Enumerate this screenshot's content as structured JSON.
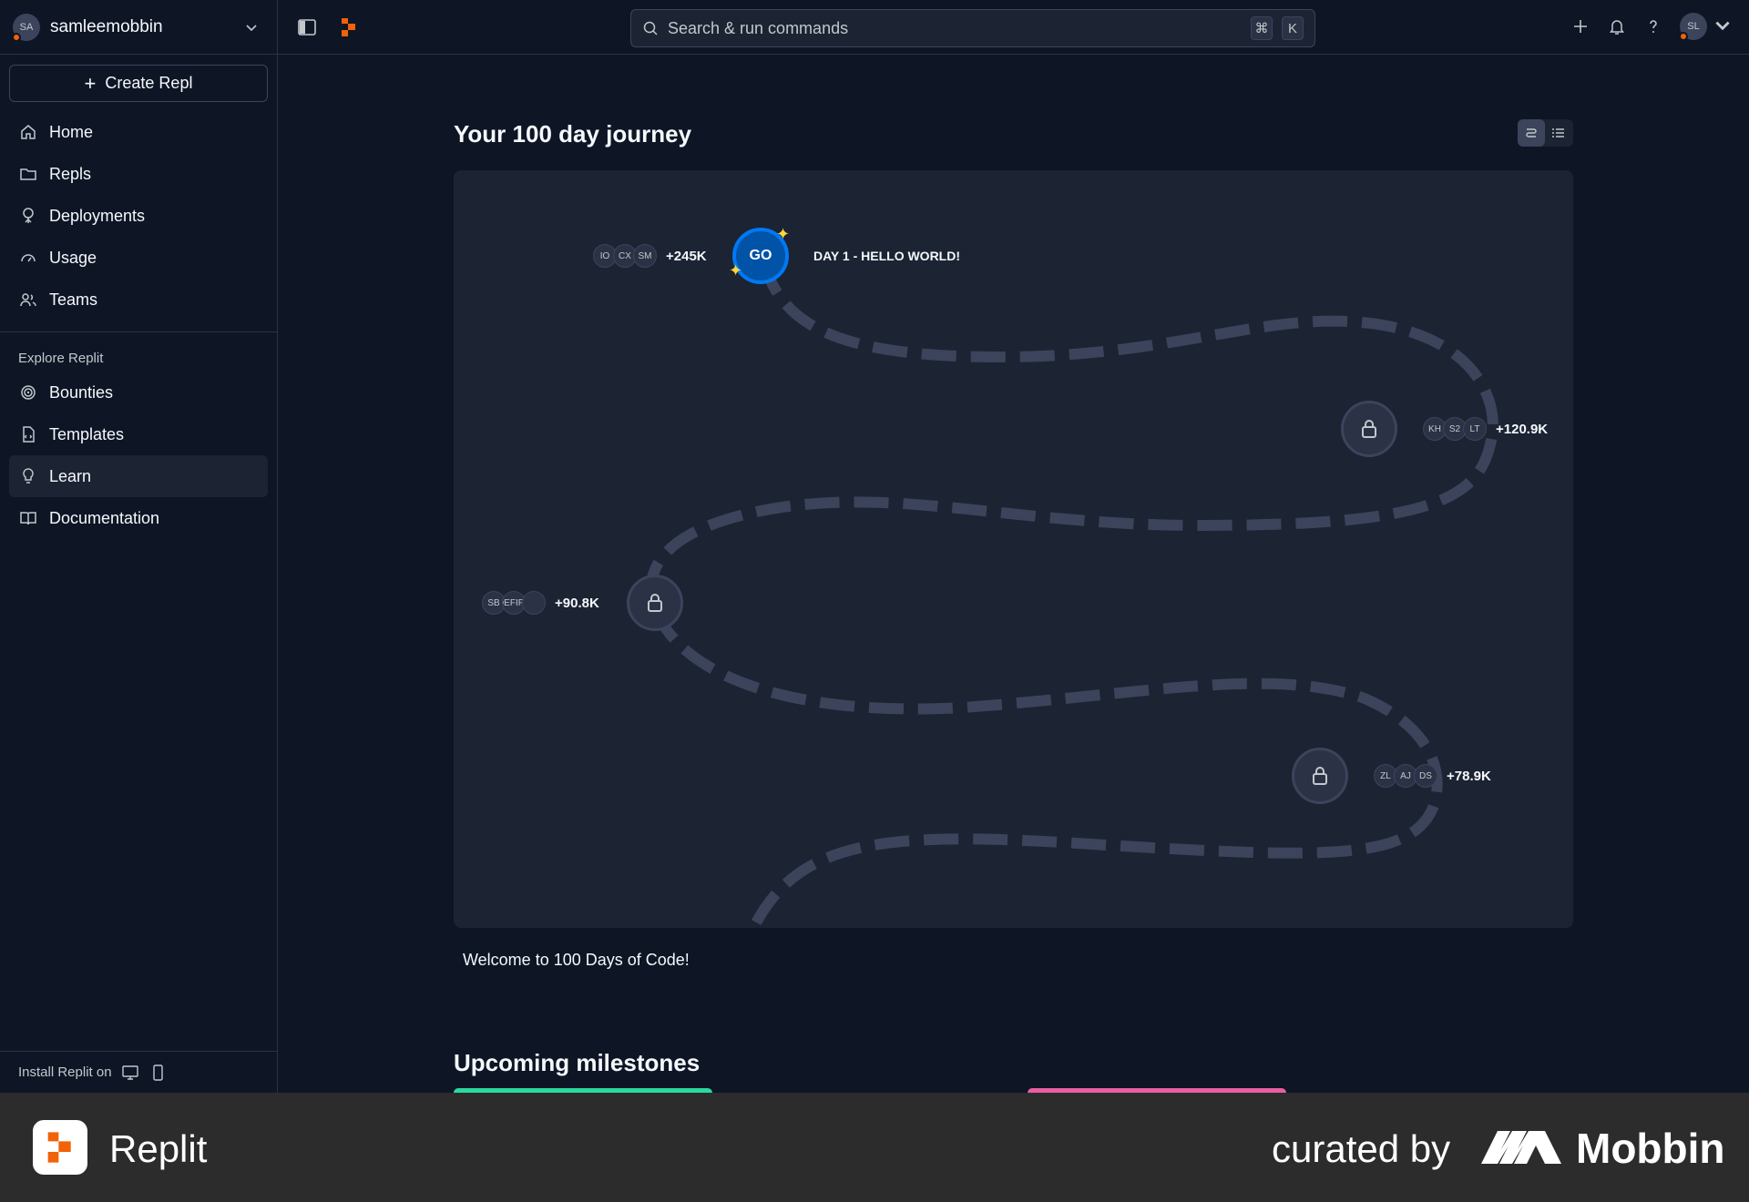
{
  "sidebar": {
    "user": {
      "initials": "SA",
      "name": "samleemobbin"
    },
    "create_label": "Create Repl",
    "nav": [
      {
        "label": "Home",
        "icon": "home-icon"
      },
      {
        "label": "Repls",
        "icon": "folder-icon"
      },
      {
        "label": "Deployments",
        "icon": "deployments-icon"
      },
      {
        "label": "Usage",
        "icon": "gauge-icon"
      },
      {
        "label": "Teams",
        "icon": "users-icon"
      }
    ],
    "explore_label": "Explore Replit",
    "explore": [
      {
        "label": "Bounties",
        "icon": "target-icon"
      },
      {
        "label": "Templates",
        "icon": "template-icon"
      },
      {
        "label": "Learn",
        "icon": "lightbulb-icon",
        "active": true
      },
      {
        "label": "Documentation",
        "icon": "book-icon"
      }
    ],
    "install_label": "Install Replit on"
  },
  "topbar": {
    "search_placeholder": "Search & run commands",
    "shortcut": [
      "⌘",
      "K"
    ],
    "user_initials": "SL"
  },
  "main": {
    "title": "Your 100 day journey",
    "nodes": [
      {
        "label": "GO",
        "day_label": "DAY 1 - HELLO WORLD!",
        "avatars": [
          "IO",
          "CX",
          "SM"
        ],
        "count": "+245K"
      },
      {
        "avatars": [
          "KH",
          "S2",
          "LT"
        ],
        "count": "+120.9K"
      },
      {
        "avatars": [
          "SB",
          "DEFIFD",
          ""
        ],
        "count": "+90.8K"
      },
      {
        "avatars": [
          "ZL",
          "AJ",
          "DS"
        ],
        "count": "+78.9K"
      }
    ],
    "welcome": "Welcome to 100 Days of Code!",
    "milestones_title": "Upcoming milestones"
  },
  "footer": {
    "app_name": "Replit",
    "curated_by": "curated by",
    "brand": "Mobbin"
  },
  "colors": {
    "background": "#0e1525",
    "surface": "#1c2333",
    "accent_orange": "#f26207",
    "accent_blue": "#0079f2"
  }
}
